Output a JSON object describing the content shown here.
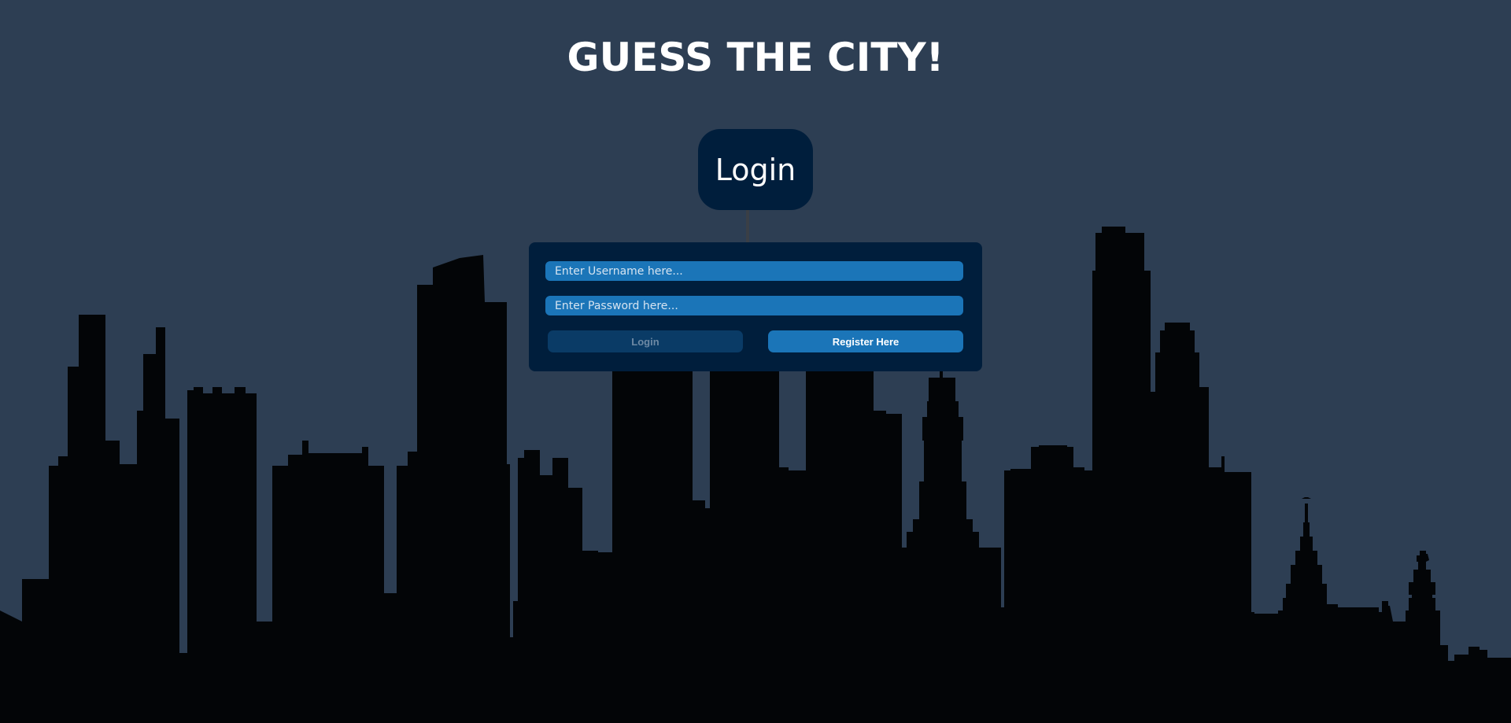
{
  "page": {
    "title": "GUESS THE CITY!"
  },
  "login_badge": {
    "label": "Login"
  },
  "form": {
    "username_placeholder": "Enter Username here...",
    "password_placeholder": "Enter Password here...",
    "login_label": "Login",
    "register_label": "Register Here"
  },
  "colors": {
    "background": "#2d3e53",
    "panel": "#001e3c",
    "field": "#1b75b8",
    "login_button": "#0a3b66",
    "skyline": "#030507"
  }
}
